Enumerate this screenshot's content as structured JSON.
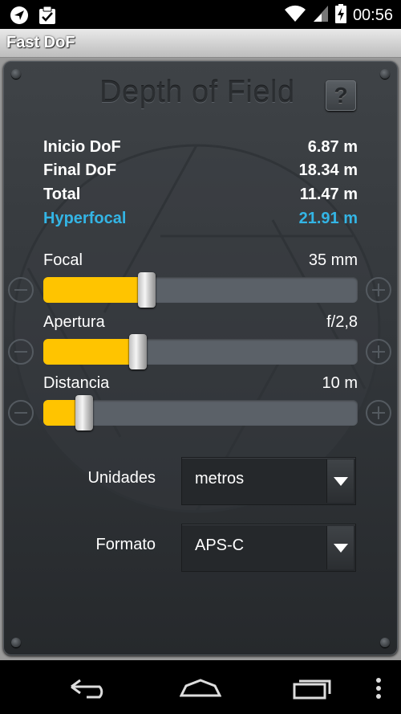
{
  "status_bar": {
    "time": "00:56",
    "icons": [
      "navigation-icon",
      "clipboard-check-icon",
      "wifi-icon",
      "cell-signal-icon",
      "battery-charging-icon"
    ]
  },
  "app": {
    "title": "Fast DoF"
  },
  "panel": {
    "title": "Depth of Field",
    "help_label": "?"
  },
  "results": [
    {
      "label": "Inicio DoF",
      "value": "6.87 m"
    },
    {
      "label": "Final DoF",
      "value": "18.34 m"
    },
    {
      "label": "Total",
      "value": "11.47 m"
    },
    {
      "label": "Hyperfocal",
      "value": "21.91 m"
    }
  ],
  "sliders": [
    {
      "label": "Focal",
      "value": "35 mm",
      "fraction": 0.33
    },
    {
      "label": "Apertura",
      "value": "f/2,8",
      "fraction": 0.3
    },
    {
      "label": "Distancia",
      "value": "10 m",
      "fraction": 0.13
    }
  ],
  "settings": {
    "units": {
      "label": "Unidades",
      "value": "metros"
    },
    "format": {
      "label": "Formato",
      "value": "APS-C"
    }
  },
  "colors": {
    "accent_yellow": "#ffc400",
    "hyperfocal_blue": "#33b5e5",
    "panel": "#3a3e42"
  },
  "nav_bar": {
    "icons": [
      "back-icon",
      "home-icon",
      "recent-apps-icon",
      "overflow-menu-icon"
    ]
  }
}
